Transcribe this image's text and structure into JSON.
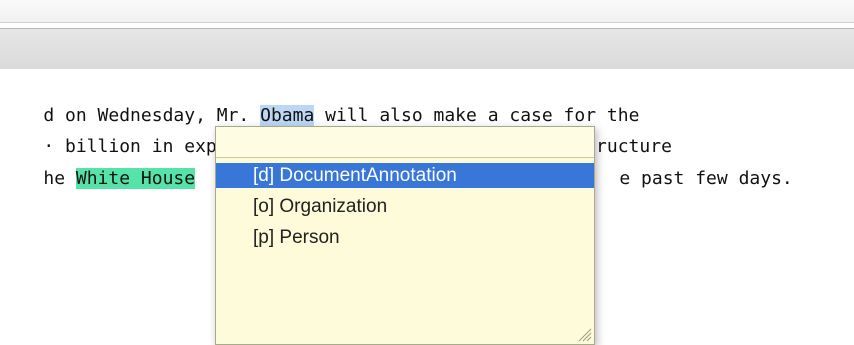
{
  "editor": {
    "line1": {
      "before": "d on Wednesday, Mr. ",
      "highlight": "Obama",
      "after": " will also make a case for the"
    },
    "line2": {
      "text": "· billion in expanded business tax cuts and infrastructure"
    },
    "line3": {
      "before": "he ",
      "highlight": "White House",
      "after": "",
      "tail": "e past few days."
    }
  },
  "popup": {
    "input_value": "",
    "options": [
      {
        "label": "[d] DocumentAnnotation",
        "selected": true
      },
      {
        "label": "[o] Organization",
        "selected": false
      },
      {
        "label": "[p] Person",
        "selected": false
      }
    ],
    "resize_grip_icon": "resize-grip-icon"
  },
  "colors": {
    "selection": "#3876d8",
    "popup_background": "#fdfbd9",
    "highlight_person": "#bcd6f3",
    "highlight_organization": "#55e3a8"
  }
}
